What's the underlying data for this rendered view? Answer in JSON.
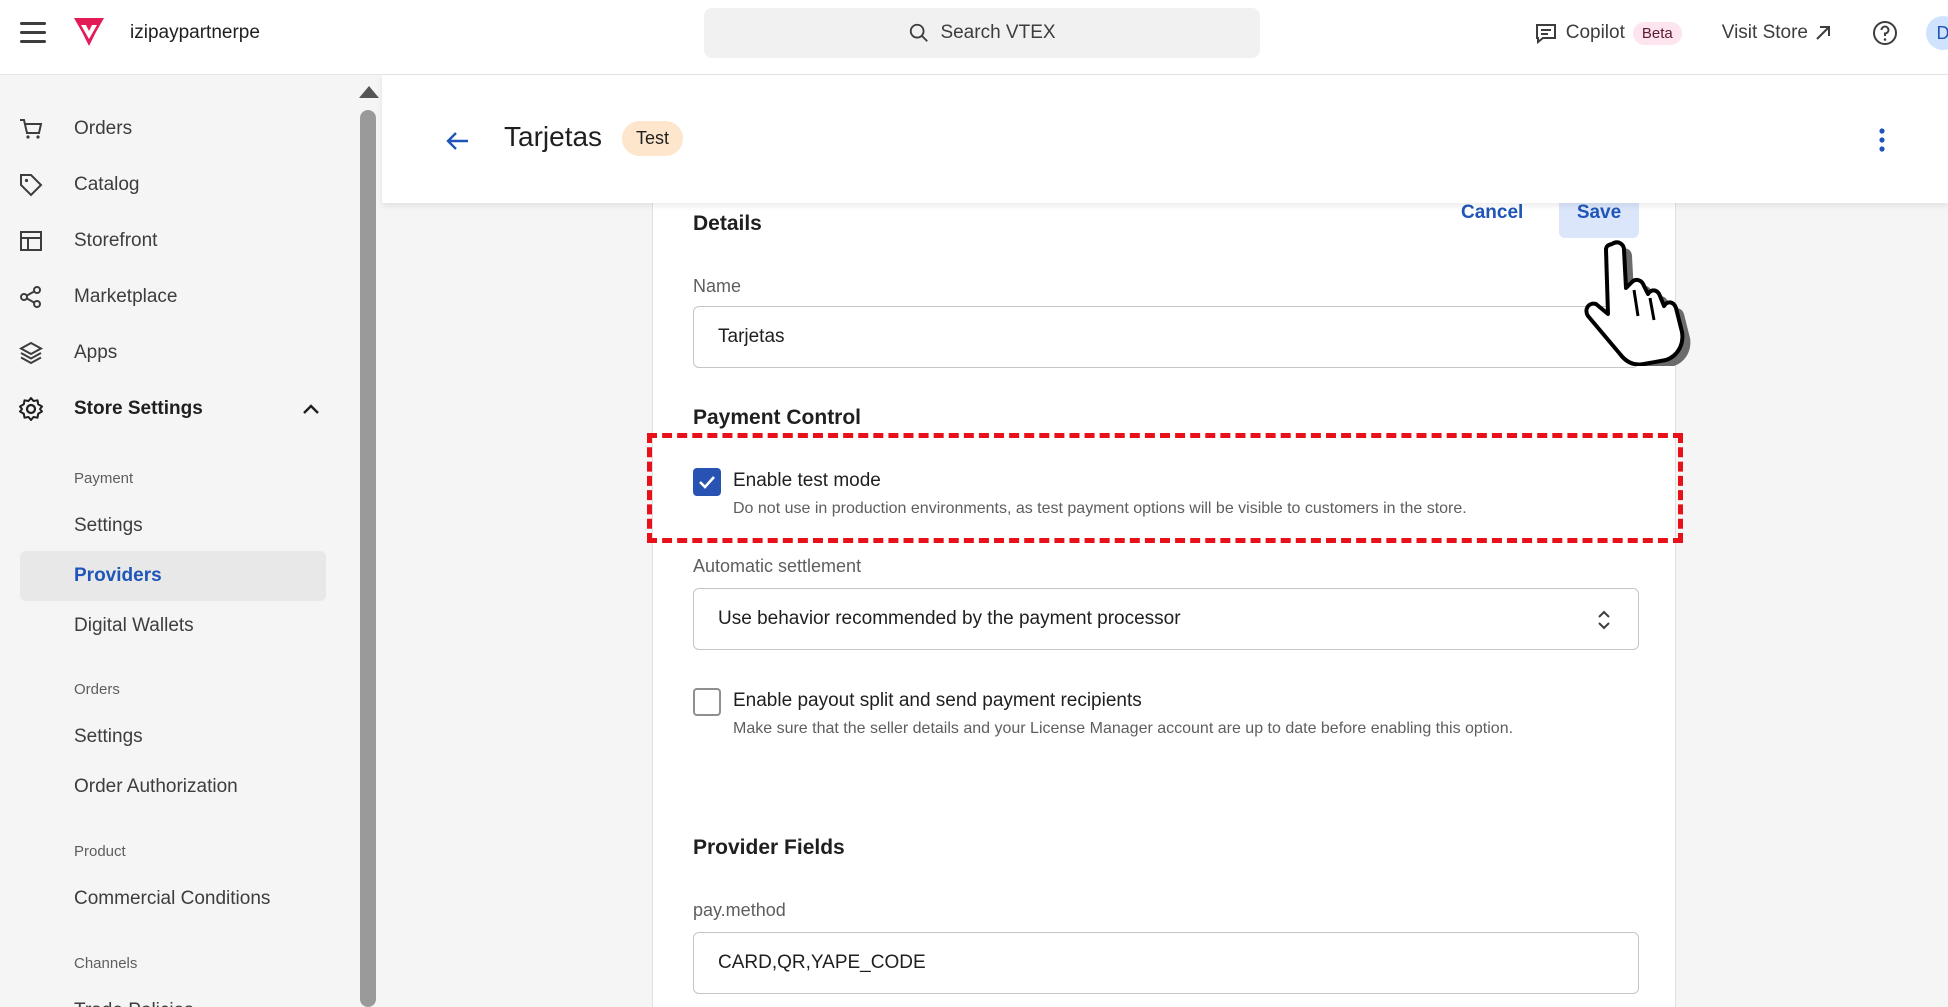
{
  "topbar": {
    "account": "izipaypartnerpe",
    "search_label": "Search VTEX",
    "copilot_label": "Copilot",
    "copilot_badge": "Beta",
    "visit_store_label": "Visit Store",
    "avatar_initial": "D"
  },
  "sidebar": {
    "items": [
      {
        "label": "Orders",
        "icon": "cart-icon"
      },
      {
        "label": "Catalog",
        "icon": "tag-icon"
      },
      {
        "label": "Storefront",
        "icon": "layout-icon"
      },
      {
        "label": "Marketplace",
        "icon": "share-icon"
      },
      {
        "label": "Apps",
        "icon": "layers-icon"
      },
      {
        "label": "Store Settings",
        "icon": "gear-icon",
        "expanded": true
      }
    ],
    "groups": [
      {
        "label": "Payment",
        "items": [
          {
            "label": "Settings"
          },
          {
            "label": "Providers",
            "active": true
          },
          {
            "label": "Digital Wallets"
          }
        ]
      },
      {
        "label": "Orders",
        "items": [
          {
            "label": "Settings"
          },
          {
            "label": "Order Authorization"
          }
        ]
      },
      {
        "label": "Product",
        "items": [
          {
            "label": "Commercial Conditions"
          }
        ]
      },
      {
        "label": "Channels",
        "items": [
          {
            "label": "Trade Policies"
          }
        ]
      }
    ]
  },
  "header": {
    "title": "Tarjetas",
    "badge": "Test"
  },
  "details": {
    "title": "Details",
    "cancel_label": "Cancel",
    "save_label": "Save",
    "name_label": "Name",
    "name_value": "Tarjetas"
  },
  "payment_control": {
    "title": "Payment Control",
    "test_mode_label": "Enable test mode",
    "test_mode_checked": true,
    "test_mode_help": "Do not use in production environments, as test payment options will be visible to customers in the store.",
    "settlement_label": "Automatic settlement",
    "settlement_value": "Use behavior recommended by the payment processor",
    "payout_label": "Enable payout split and send payment recipients",
    "payout_checked": false,
    "payout_help": "Make sure that the seller details and your License Manager account are up to date before enabling this option."
  },
  "provider_fields": {
    "title": "Provider Fields",
    "method_label": "pay.method",
    "method_value": "CARD,QR,YAPE_CODE"
  },
  "colors": {
    "accent": "#1f55b8",
    "checkbox": "#2953b2",
    "highlight": "#e8111a",
    "badge_bg": "#fde6cc",
    "brand": "#e31c58"
  }
}
